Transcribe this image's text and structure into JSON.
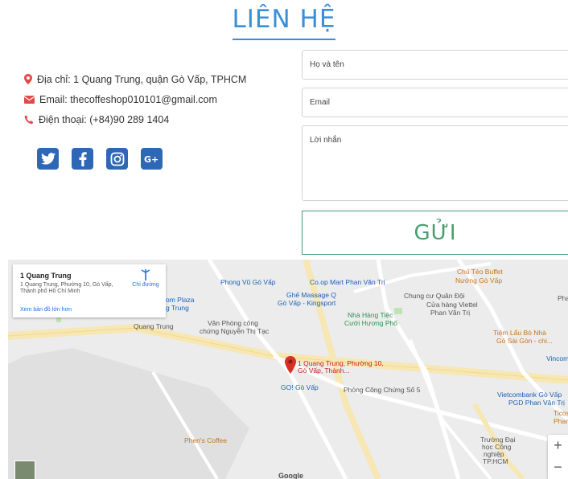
{
  "header": {
    "title": "LIÊN HỆ"
  },
  "contact": {
    "address": "Địa chỉ: 1 Quang Trung, quận Gò Vấp, TPHCM",
    "email": "Email: thecoffeshop010101@gmail.com",
    "phone": "Điện thoại: (+84)90 289 1404"
  },
  "social": [
    "twitter-icon",
    "facebook-icon",
    "instagram-icon",
    "google-plus-icon"
  ],
  "form": {
    "name_placeholder": "Họ và tên",
    "email_placeholder": "Email",
    "message_placeholder": "Lời nhắn",
    "send_label": "GỬI"
  },
  "map": {
    "card_title": "1 Quang Trung",
    "card_address": "1 Quang Trung, Phường 10, Gò Vấp, Thành phố Hồ Chí Minh",
    "directions": "Chỉ đường",
    "larger_map": "Xem bản đồ lớn hơn",
    "pin_label": "1 Quang Trung, Phường 10, Gò Vấp, Thành...",
    "pois": {
      "phong_vu": "Phong Vũ Gò Vấp",
      "coop": "Co.op Mart Phan Văn Trị",
      "chung_cu": "Chung cư Quân Đội",
      "chu_teo": "Chú Tèo Buffet",
      "nuong": "Nướng Gò Vấp",
      "ghe_massage": "Ghế Massage Q",
      "kingsport": "Gò Vấp - Kingsport",
      "viettel": "Cửa hàng Viettel",
      "viettel2": "Phan Văn Trị",
      "nha_hang": "Nhà Hàng Tiệc",
      "cuoi": "Cưới Hương Phố",
      "plaza": "om Plaza",
      "plaza2": "g Trung",
      "quang_trung": "Quang Trung",
      "van_phong": "Văn Phòng công",
      "van_phong2": "chứng Nguyễn Thị Tạc",
      "tiem_lau": "Tiệm Lẩu Bò Nhà",
      "sai_gon": "Gò Sài Gòn - chi...",
      "gol": "GO! Gò Vấp",
      "cong_chung": "Phòng Công Chứng Số 5",
      "vietcombank": "Vietcombank Gò Vấp",
      "vietcombank2": "PGD Phan Văn Trị",
      "ticos": "Ticos Coffe",
      "ticos2": "Phan Văn Tr",
      "phens": "Phen's Coffee",
      "dai_hoc": "Trường Đại",
      "dai_hoc2": "học Công",
      "dai_hoc3": "nghiệp",
      "dai_hoc4": "TP.HCM",
      "vincom": "Vincom",
      "pha": "Pha"
    },
    "zoom_in": "+",
    "zoom_out": "−",
    "google": "Google"
  }
}
